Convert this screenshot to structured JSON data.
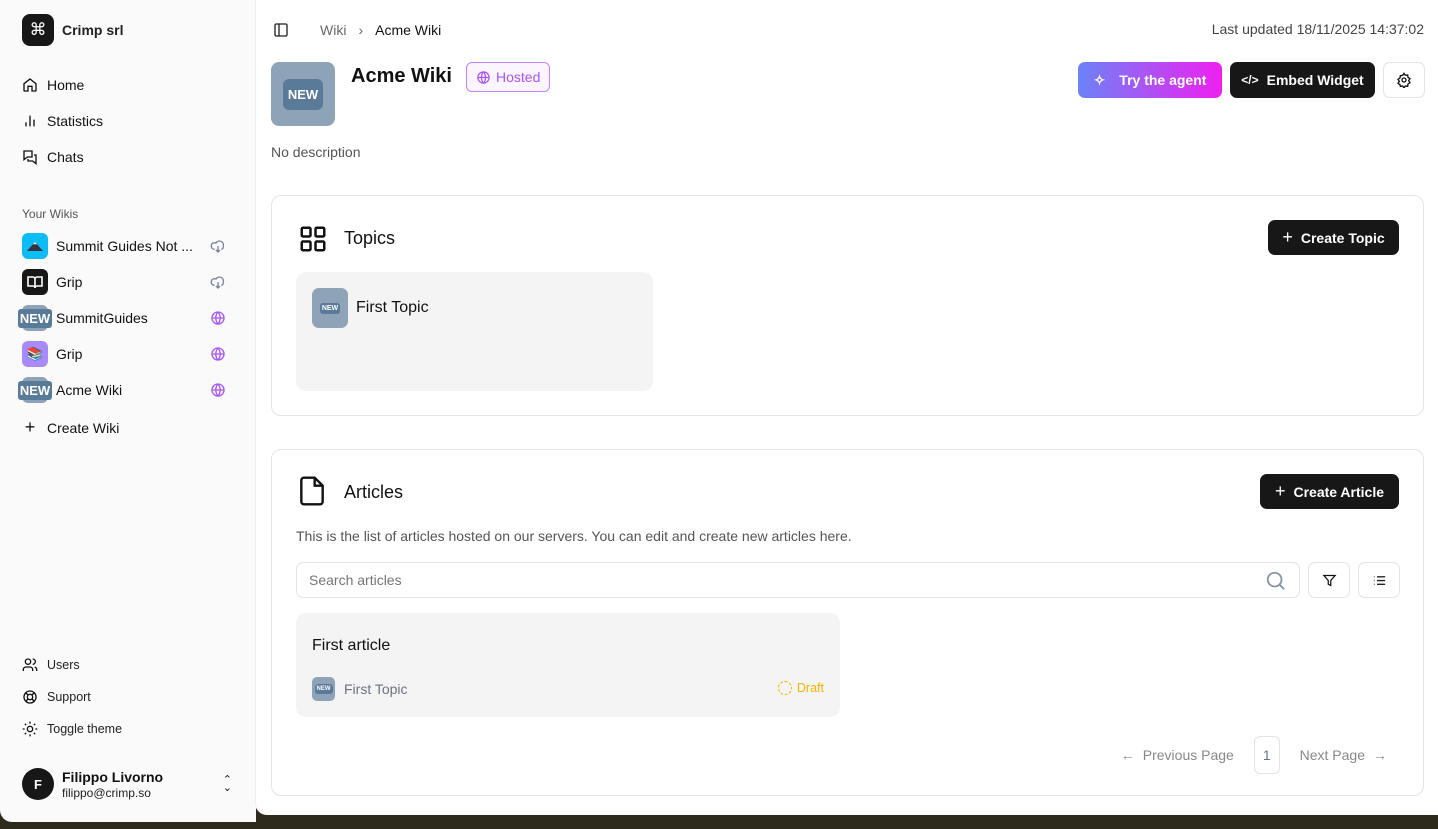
{
  "org": {
    "name": "Crimp srl"
  },
  "nav": [
    {
      "label": "Home"
    },
    {
      "label": "Statistics"
    },
    {
      "label": "Chats"
    }
  ],
  "wikis_heading": "Your Wikis",
  "wikis": [
    {
      "label": "Summit Guides Not ...",
      "status": "cloud-download"
    },
    {
      "label": "Grip",
      "status": "cloud-download"
    },
    {
      "label": "SummitGuides",
      "status": "globe"
    },
    {
      "label": "Grip",
      "status": "globe"
    },
    {
      "label": "Acme Wiki",
      "status": "globe"
    }
  ],
  "create_wiki": "Create Wiki",
  "footer_nav": [
    {
      "label": "Users"
    },
    {
      "label": "Support"
    },
    {
      "label": "Toggle theme"
    }
  ],
  "user": {
    "initial": "F",
    "name": "Filippo Livorno",
    "email": "filippo@crimp.so"
  },
  "breadcrumb": [
    "Wiki",
    "Acme Wiki"
  ],
  "last_updated": "Last updated 18/11/2025 14:37:02",
  "wiki": {
    "icon_text": "NEW",
    "title": "Acme Wiki",
    "badge": "Hosted",
    "description": "No description"
  },
  "actions": {
    "try_agent": "Try the agent",
    "embed": "Embed Widget"
  },
  "topics": {
    "title": "Topics",
    "create": "Create Topic",
    "items": [
      {
        "icon_text": "NEW",
        "title": "First Topic"
      }
    ]
  },
  "articles": {
    "title": "Articles",
    "create": "Create Article",
    "description": "This is the list of articles hosted on our servers. You can edit and create new articles here.",
    "search_placeholder": "Search articles",
    "items": [
      {
        "title": "First article",
        "topic": "First Topic",
        "topic_icon_text": "NEW",
        "status": "Draft"
      }
    ]
  },
  "pagination": {
    "prev": "Previous Page",
    "page": "1",
    "next": "Next Page"
  },
  "colors": {
    "accent": "#a855f7",
    "draft": "#f5b400",
    "dark": "#171717"
  }
}
